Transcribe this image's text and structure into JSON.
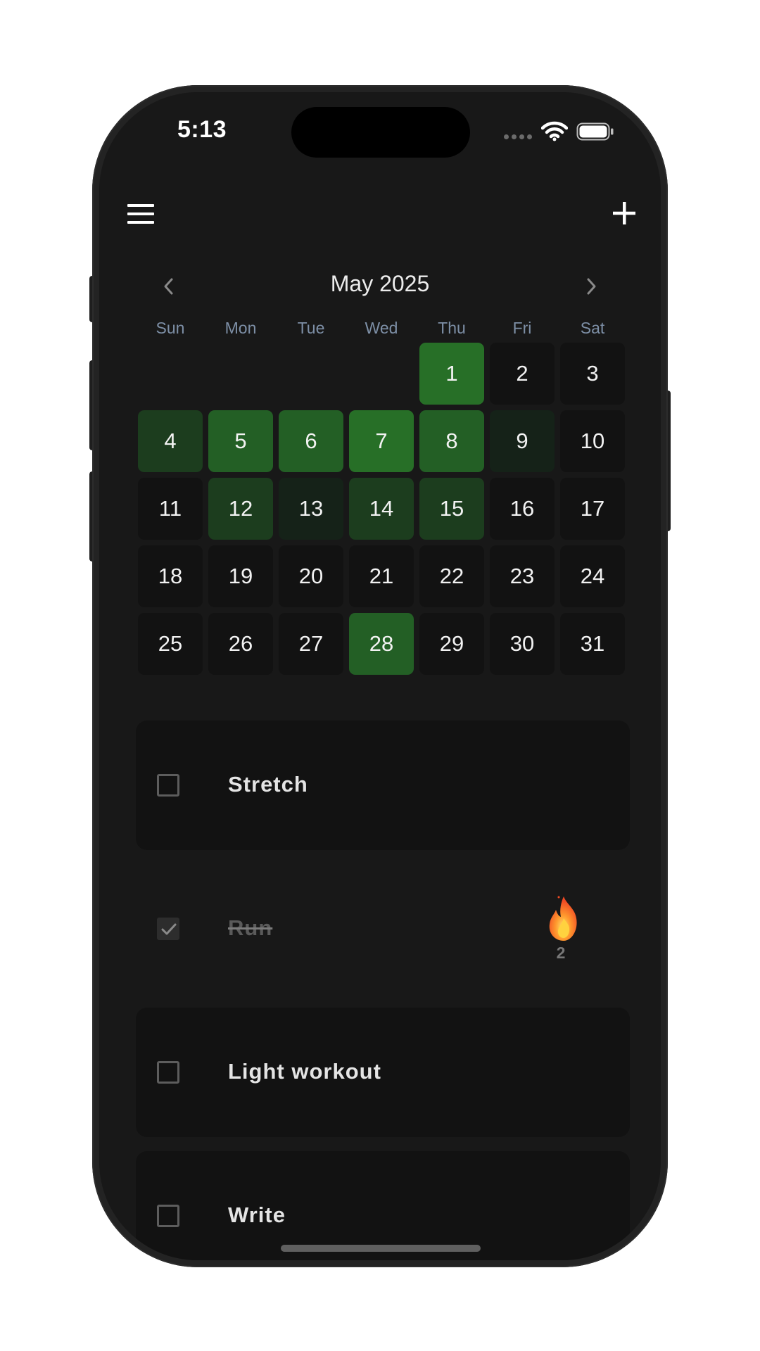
{
  "status_bar": {
    "time": "5:13",
    "icons": [
      "cellular-signal-icon",
      "wifi-icon",
      "battery-icon"
    ]
  },
  "toolbar": {
    "menu_icon": "hamburger-menu-icon",
    "add_icon": "plus-icon"
  },
  "calendar": {
    "month_label": "May 2025",
    "prev_icon": "chevron-left-icon",
    "next_icon": "chevron-right-icon",
    "weekdays": [
      "Sun",
      "Mon",
      "Tue",
      "Wed",
      "Thu",
      "Fri",
      "Sat"
    ],
    "first_weekday_index": 4,
    "days": [
      {
        "label": "1",
        "completion": 1.0
      },
      {
        "label": "2",
        "completion": 0
      },
      {
        "label": "3",
        "completion": 0
      },
      {
        "label": "4",
        "completion": 0.5
      },
      {
        "label": "5",
        "completion": 0.75
      },
      {
        "label": "6",
        "completion": 0.75
      },
      {
        "label": "7",
        "completion": 1.0
      },
      {
        "label": "8",
        "completion": 0.75
      },
      {
        "label": "9",
        "completion": 0.25
      },
      {
        "label": "10",
        "completion": 0
      },
      {
        "label": "11",
        "completion": 0
      },
      {
        "label": "12",
        "completion": 0.5
      },
      {
        "label": "13",
        "completion": 0.25
      },
      {
        "label": "14",
        "completion": 0.5
      },
      {
        "label": "15",
        "completion": 0.5
      },
      {
        "label": "16",
        "completion": 0
      },
      {
        "label": "17",
        "completion": 0
      },
      {
        "label": "18",
        "completion": 0
      },
      {
        "label": "19",
        "completion": 0
      },
      {
        "label": "20",
        "completion": 0
      },
      {
        "label": "21",
        "completion": 0
      },
      {
        "label": "22",
        "completion": 0
      },
      {
        "label": "23",
        "completion": 0
      },
      {
        "label": "24",
        "completion": 0
      },
      {
        "label": "25",
        "completion": 0
      },
      {
        "label": "26",
        "completion": 0
      },
      {
        "label": "27",
        "completion": 0
      },
      {
        "label": "28",
        "completion": 0.75
      },
      {
        "label": "29",
        "completion": 0
      },
      {
        "label": "30",
        "completion": 0
      },
      {
        "label": "31",
        "completion": 0
      }
    ]
  },
  "habits": [
    {
      "name": "Stretch",
      "checked": false
    },
    {
      "name": "Run",
      "checked": true,
      "streak_icon": "flame-icon",
      "streak": "2"
    },
    {
      "name": "Light workout",
      "checked": false
    },
    {
      "name": "Write",
      "checked": false
    }
  ],
  "colors": {
    "screen_bg": "#181818",
    "cell_bg": "#121212",
    "accent_green": "#276f27",
    "weekday_text": "#7d8fa6"
  }
}
